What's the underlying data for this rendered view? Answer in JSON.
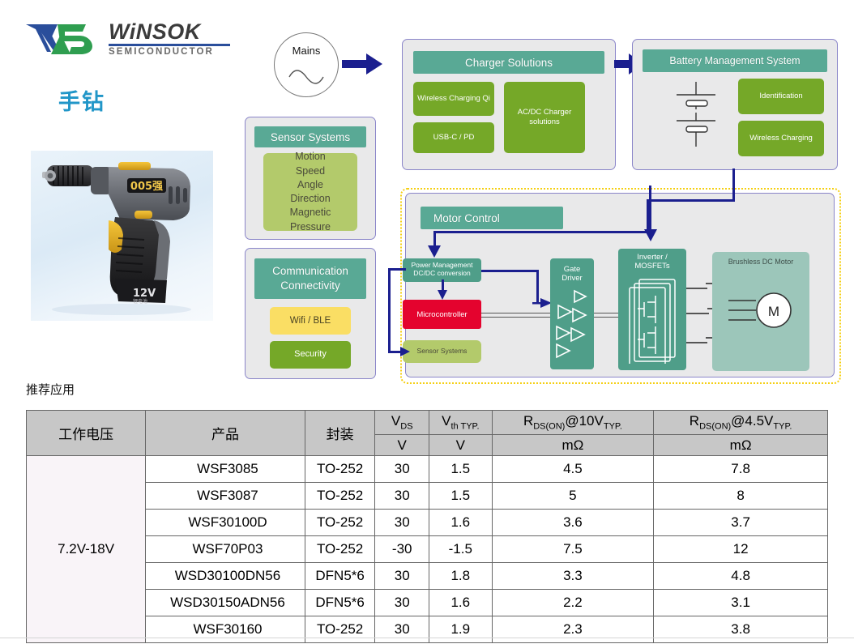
{
  "brand": {
    "name": "WiNSOK",
    "subtitle": "SEMICONDUCTOR",
    "logo_icon": "winsok-w-logo",
    "colors": {
      "navy": "#2a4e9b",
      "green": "#2f9e50",
      "dark_gray": "#3b3b3b"
    }
  },
  "product": {
    "title": "手钻",
    "photo_alt": "cordless-hand-drill",
    "title_color": "#2196c8"
  },
  "section": {
    "recommended_label": "推荐应用"
  },
  "diagram": {
    "mains": {
      "label": "Mains",
      "icon": "ac-sine-wave-icon"
    },
    "charger": {
      "header": "Charger Solutions",
      "blocks": [
        {
          "label": "Wireless Charging Qi"
        },
        {
          "label": "USB-C / PD"
        },
        {
          "label": "AC/DC Charger solutions"
        }
      ]
    },
    "bms": {
      "header": "Battery Management System",
      "battery_icon": "battery-cell-symbol",
      "blocks": [
        {
          "label": "Identification"
        },
        {
          "label": "Wireless Charging"
        }
      ]
    },
    "sensor_systems": {
      "header": "Sensor Systems",
      "items": [
        "Motion",
        "Speed",
        "Angle",
        "Direction",
        "Magnetic",
        "Pressure"
      ]
    },
    "communication": {
      "header_line1": "Communication",
      "header_line2": "Connectivity",
      "blocks": [
        {
          "label": "Wifi / BLE"
        },
        {
          "label": "Security"
        }
      ]
    },
    "motor_control": {
      "header": "Motor Control",
      "power_management_line1": "Power Management",
      "power_management_line2": "DC/DC conversion",
      "microcontroller": "Microcontroller",
      "sensor_systems": "Sensor Systems",
      "gate_driver_line1": "Gate",
      "gate_driver_line2": "Driver",
      "inverter_line1": "Inverter /",
      "inverter_line2": "MOSFETs",
      "motor_block": "Brushless DC Motor",
      "motor_symbol": "M"
    },
    "colors": {
      "teal_header": "#59a995",
      "green_block": "#75a828",
      "olive_block": "#b3ca6b",
      "yellow_block": "#fade64",
      "red_block": "#e4032e",
      "arrow_navy": "#1b1f8f",
      "panel_border": "#8a85c9",
      "panel_fill": "#e9e9ea",
      "dashed_border": "#f5cf12"
    }
  },
  "table": {
    "headers_top": [
      "工作电压",
      "产品",
      "封装",
      "V_DS",
      "V_th TYP.",
      "R_DS(ON)@10V_TYP.",
      "R_DS(ON)@4.5V_TYP."
    ],
    "headers_unit": [
      "V",
      "V",
      "mΩ",
      "mΩ"
    ],
    "voltage_range": "7.2V-18V",
    "rows": [
      {
        "product": "WSF3085",
        "package": "TO-252",
        "vds": "30",
        "vth": "1.5",
        "rds10": "4.5",
        "rds45": "7.8"
      },
      {
        "product": "WSF3087",
        "package": "TO-252",
        "vds": "30",
        "vth": "1.5",
        "rds10": "5",
        "rds45": "8"
      },
      {
        "product": "WSF30100D",
        "package": "TO-252",
        "vds": "30",
        "vth": "1.6",
        "rds10": "3.6",
        "rds45": "3.7"
      },
      {
        "product": "WSF70P03",
        "package": "TO-252",
        "vds": "-30",
        "vth": "-1.5",
        "rds10": "7.5",
        "rds45": "12"
      },
      {
        "product": "WSD30100DN56",
        "package": "DFN5*6",
        "vds": "30",
        "vth": "1.8",
        "rds10": "3.3",
        "rds45": "4.8"
      },
      {
        "product": "WSD30150ADN56",
        "package": "DFN5*6",
        "vds": "30",
        "vth": "1.6",
        "rds10": "2.2",
        "rds45": "3.1"
      },
      {
        "product": "WSF30160",
        "package": "TO-252",
        "vds": "30",
        "vth": "1.9",
        "rds10": "2.3",
        "rds45": "3.8"
      }
    ]
  }
}
